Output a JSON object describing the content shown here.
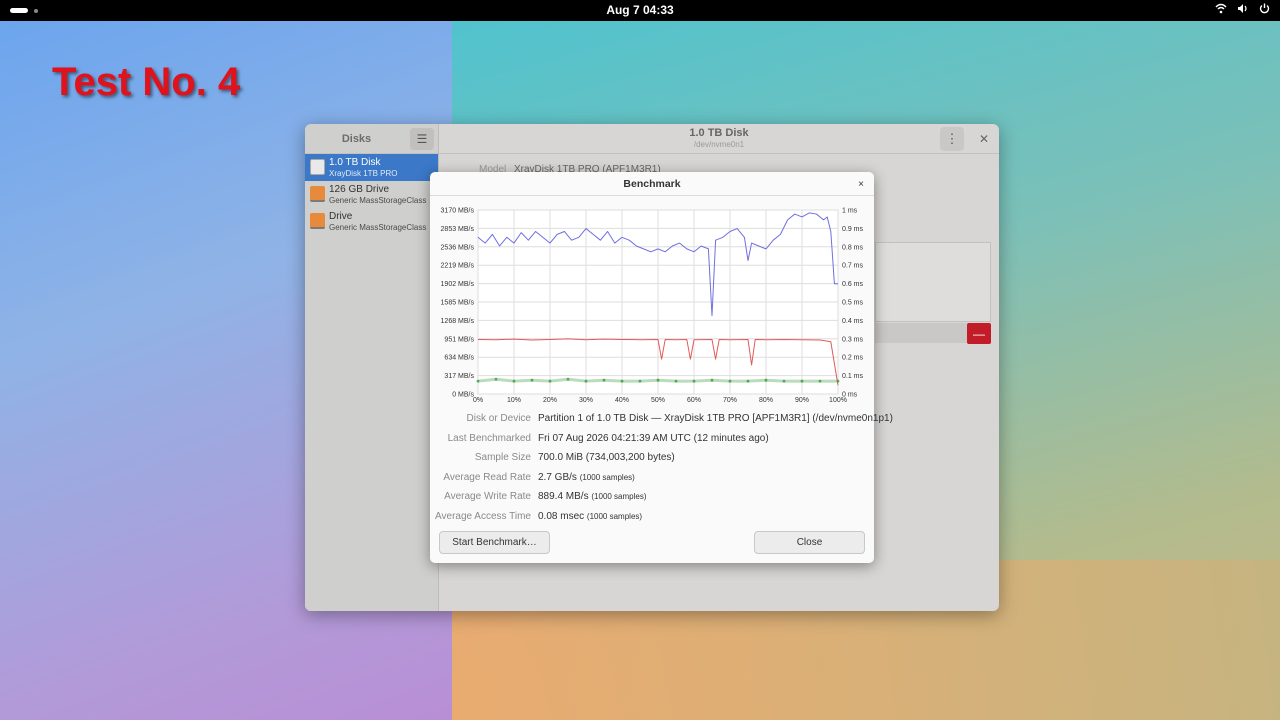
{
  "topbar": {
    "clock": "Aug 7  04:33",
    "icons": [
      "wifi-icon",
      "volume-icon",
      "power-icon"
    ]
  },
  "overlay_label": "Test No. 4",
  "disks_window": {
    "sidebar_title": "Disks",
    "drives": [
      {
        "name": "1.0 TB Disk",
        "subtitle": "XrayDisk 1TB PRO",
        "icon": "ssd-icon",
        "selected": true
      },
      {
        "name": "126 GB Drive",
        "subtitle": "Generic MassStorageClass",
        "icon": "usb-drive-icon",
        "selected": false
      },
      {
        "name": "Drive",
        "subtitle": "Generic MassStorageClass",
        "icon": "usb-drive-icon",
        "selected": false
      }
    ],
    "title": "1.0 TB Disk",
    "subtitle": "/dev/nvme0n1",
    "model_label": "Model",
    "model_value": "XrayDisk 1TB PRO (APF1M3R1)",
    "delete_symbol": "—"
  },
  "benchmark": {
    "title": "Benchmark",
    "close_symbol": "×",
    "info": {
      "disk_label": "Disk or Device",
      "disk_value": "Partition 1 of 1.0 TB Disk — XrayDisk 1TB PRO [APF1M3R1] (/dev/nvme0n1p1)",
      "last_label": "Last Benchmarked",
      "last_value": "Fri 07 Aug 2026 04:21:39 AM UTC (12 minutes ago)",
      "sample_label": "Sample Size",
      "sample_value": "700.0 MiB (734,003,200 bytes)",
      "read_label": "Average Read Rate",
      "read_value": "2.7 GB/s",
      "read_samples": "(1000 samples)",
      "write_label": "Average Write Rate",
      "write_value": "889.4 MB/s",
      "write_samples": "(1000 samples)",
      "access_label": "Average Access Time",
      "access_value": "0.08 msec",
      "access_samples": "(1000 samples)"
    },
    "start_button": "Start Benchmark…",
    "close_button": "Close"
  },
  "chart_data": {
    "type": "line",
    "x_ticks": [
      "0%",
      "10%",
      "20%",
      "30%",
      "40%",
      "50%",
      "60%",
      "70%",
      "80%",
      "90%",
      "100%"
    ],
    "y_left_ticks": [
      "3170 MB/s",
      "2853 MB/s",
      "2536 MB/s",
      "2219 MB/s",
      "1902 MB/s",
      "1585 MB/s",
      "1268 MB/s",
      "951 MB/s",
      "634 MB/s",
      "317 MB/s",
      "0 MB/s"
    ],
    "y_right_ticks": [
      "1 ms",
      "0.9 ms",
      "0.8 ms",
      "0.7 ms",
      "0.6 ms",
      "0.5 ms",
      "0.4 ms",
      "0.3 ms",
      "0.2 ms",
      "0.1 ms",
      "0 ms"
    ],
    "xlim": [
      0,
      100
    ],
    "ylim_left": [
      0,
      3170
    ],
    "ylim_right": [
      0,
      1
    ],
    "grid": true,
    "series": [
      {
        "color": "#6f6fe0",
        "x": [
          0,
          2,
          4,
          6,
          8,
          10,
          12,
          14,
          16,
          18,
          20,
          22,
          24,
          26,
          28,
          30,
          32,
          34,
          36,
          38,
          40,
          42,
          44,
          46,
          48,
          50,
          52,
          54,
          56,
          58,
          60,
          62,
          64,
          65,
          66,
          68,
          70,
          72,
          74,
          75,
          76,
          78,
          80,
          82,
          84,
          86,
          88,
          90,
          92,
          94,
          96,
          97,
          98,
          99,
          100
        ],
        "y": [
          2700,
          2600,
          2750,
          2550,
          2700,
          2600,
          2780,
          2650,
          2800,
          2700,
          2600,
          2750,
          2800,
          2650,
          2700,
          2850,
          2750,
          2650,
          2800,
          2600,
          2700,
          2650,
          2550,
          2500,
          2450,
          2500,
          2450,
          2550,
          2600,
          2500,
          2450,
          2550,
          2500,
          1350,
          2650,
          2700,
          2800,
          2850,
          2700,
          2300,
          2600,
          2550,
          2500,
          2650,
          2750,
          3000,
          3100,
          3050,
          3120,
          3100,
          3000,
          3050,
          2800,
          1900,
          1900
        ]
      },
      {
        "color": "#e05a5a",
        "x": [
          0,
          5,
          10,
          15,
          20,
          25,
          30,
          35,
          40,
          45,
          50,
          51,
          52,
          55,
          58,
          59,
          60,
          65,
          66,
          67,
          70,
          75,
          76,
          77,
          80,
          85,
          90,
          95,
          98,
          100
        ],
        "y": [
          940,
          935,
          945,
          930,
          940,
          950,
          935,
          945,
          940,
          935,
          940,
          600,
          940,
          935,
          940,
          600,
          935,
          940,
          600,
          940,
          935,
          940,
          500,
          940,
          935,
          940,
          935,
          930,
          900,
          150
        ]
      },
      {
        "color": "#3a9a3a",
        "x": [
          0,
          5,
          10,
          15,
          20,
          25,
          30,
          35,
          40,
          45,
          50,
          55,
          60,
          65,
          70,
          75,
          80,
          85,
          90,
          95,
          100
        ],
        "y": [
          0.07,
          0.08,
          0.07,
          0.075,
          0.07,
          0.08,
          0.07,
          0.075,
          0.07,
          0.07,
          0.075,
          0.07,
          0.07,
          0.075,
          0.07,
          0.07,
          0.075,
          0.07,
          0.07,
          0.07,
          0.07
        ],
        "axis": "right"
      }
    ]
  }
}
